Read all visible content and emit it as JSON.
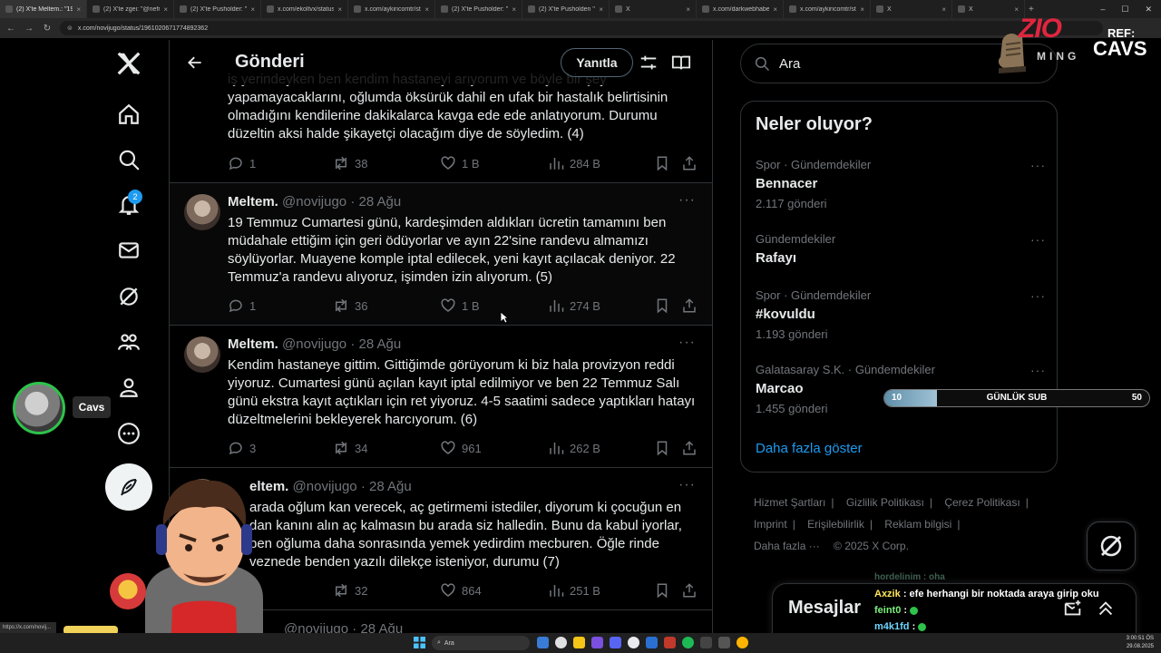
{
  "browser": {
    "tabs": [
      {
        "label": "(2) X'te Meltem.: \"19 T",
        "active": true
      },
      {
        "label": "(2) X'te zgei: \"@nefret"
      },
      {
        "label": "(2) X'te Pusholder: \"M"
      },
      {
        "label": "x.com/ekoltvx/status/"
      },
      {
        "label": "x.com/aykiricomtr/stat"
      },
      {
        "label": "(2) X'te Pusholder: \"Bu"
      },
      {
        "label": "(2) X'te Pusholden \"[p"
      },
      {
        "label": "X"
      },
      {
        "label": "x.com/darkwebhaber"
      },
      {
        "label": "x.com/aykiricomtr/stat"
      },
      {
        "label": "X"
      },
      {
        "label": "X"
      }
    ],
    "url": "x.com/novijugo/status/1961020671774892362",
    "status_url": "https://x.com/novij..."
  },
  "nav": {
    "notification_count": "2",
    "profile_label": "Cavs"
  },
  "header": {
    "title": "Gönderi",
    "reply_label": "Yanıtla"
  },
  "posts": [
    {
      "name": "",
      "handle": "",
      "date": "",
      "text": "iş yerindeyken ben kendim hastaneyi arıyorum ve böyle bir şey yapamayacaklarını, oğlumda öksürük dahil en ufak bir hastalık belirtisinin olmadığını kendilerine dakikalarca kavga ede ede anlatıyorum. Durumu düzeltin aksi halde şikayetçi olacağım diye de söyledim. (4)",
      "replies": "1",
      "reposts": "38",
      "likes": "1 B",
      "views": "284 B"
    },
    {
      "name": "Meltem.",
      "handle": "@novijugo",
      "date": "· 28 Ağu",
      "text": "19 Temmuz Cumartesi günü, kardeşimden aldıkları ücretin tamamını ben müdahale ettiğim için geri ödüyorlar ve ayın 22'sine randevu almamızı söylüyorlar. Muayene komple iptal edilecek, yeni kayıt açılacak deniyor. 22 Temmuz'a randevu alıyoruz, işimden izin alıyorum. (5)",
      "replies": "1",
      "reposts": "36",
      "likes": "1 B",
      "views": "274 B"
    },
    {
      "name": "Meltem.",
      "handle": "@novijugo",
      "date": "· 28 Ağu",
      "text": "Kendim hastaneye gittim. Gittiğimde görüyorum ki biz hala provizyon reddi yiyoruz. Cumartesi günü açılan kayıt iptal edilmiyor ve ben 22 Temmuz Salı günü ekstra kayıt açtıkları için ret yiyoruz. 4-5 saatimi sadece yaptıkları hatayı düzeltmelerini bekleyerek harcıyorum. (6)",
      "replies": "3",
      "reposts": "34",
      "likes": "961",
      "views": "262 B"
    },
    {
      "name": "eltem.",
      "handle": "@novijugo",
      "date": "· 28 Ağu",
      "text": "arada oğlum kan verecek, aç getirmemi istediler, diyorum ki çocuğun en dan kanını alın aç kalmasın bu arada siz halledin. Bunu da kabul iyorlar, ben oğluma daha sonrasında yemek yedirdim mecburen. Öğle rinde veznede benden yazılı dilekçe isteniyor, durumu (7)",
      "replies": "",
      "reposts": "32",
      "likes": "864",
      "views": "251 B"
    },
    {
      "name": "",
      "handle": "@novijugo",
      "date": "· 28 Ağu",
      "text": "",
      "replies": "",
      "reposts": "",
      "likes": "",
      "views": ""
    }
  ],
  "search": {
    "placeholder": "Ara"
  },
  "trends": {
    "title": "Neler oluyor?",
    "items": [
      {
        "context": "Spor · Gündemdekiler",
        "topic": "Bennacer",
        "count": "2.117 gönderi"
      },
      {
        "context": "Gündemdekiler",
        "topic": "Rafayı",
        "count": ""
      },
      {
        "context": "Spor · Gündemdekiler",
        "topic": "#kovuldu",
        "count": "1.193 gönderi"
      },
      {
        "context": "Galatasaray S.K. · Gündemdekiler",
        "topic": "Marcao",
        "count": "1.455 gönderi"
      }
    ],
    "show_more": "Daha fazla göster"
  },
  "footer": {
    "links": [
      "Hizmet Şartları",
      "Gizlilik Politikası",
      "Çerez Politikası",
      "Imprint",
      "Erişilebilirlik",
      "Reklam bilgisi",
      "Daha fazla ···"
    ],
    "copyright": "© 2025 X Corp."
  },
  "messages": {
    "title": "Mesajlar"
  },
  "overlay": {
    "logo_brand": "ZIO",
    "logo_sub": "MING",
    "ref_label": "REF:",
    "ref_name": "CAVS",
    "sub_goal": {
      "current": "10",
      "label": "GÜNLÜK SUB",
      "target": "50",
      "progress": 0.2
    },
    "chat": [
      {
        "user": "hordelinim",
        "text": ": oha",
        "faded": true
      },
      {
        "user": "Axzik",
        "text": ": efe herhangi bir noktada araya girip oku"
      },
      {
        "user": "feint0",
        "text": ":"
      },
      {
        "user": "m4k1fd",
        "text": ":"
      }
    ]
  },
  "taskbar": {
    "search_placeholder": "Ara",
    "time": "3:00:51 ÖS",
    "date": "29.08.2025"
  },
  "colors": {
    "accent": "#1d9bf0",
    "border": "#2f3336",
    "muted": "#71767b",
    "text": "#e7e9ea"
  }
}
